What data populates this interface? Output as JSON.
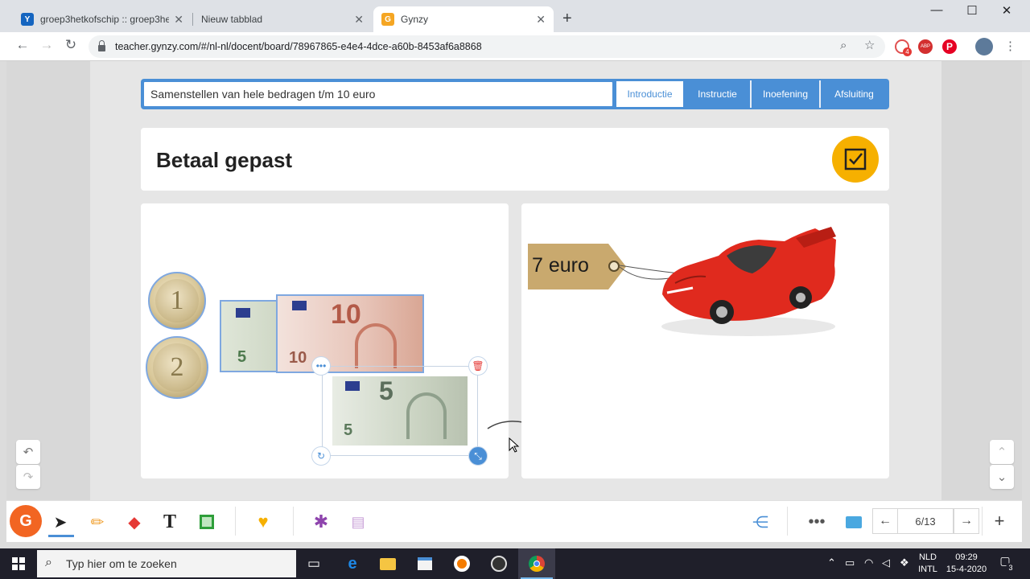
{
  "browser": {
    "tabs": [
      {
        "title": "groep3hetkofschip :: groep3hetk",
        "favicon": "Y",
        "favicon_color": "#1565c0"
      },
      {
        "title": "Nieuw tabblad",
        "favicon": "",
        "favicon_color": ""
      },
      {
        "title": "Gynzy",
        "favicon": "G",
        "favicon_color": "#f5a623"
      }
    ],
    "url": "teacher.gynzy.com/#/nl-nl/docent/board/78967865-e4e4-4dce-a60b-8453af6a8868",
    "extension_badge": "4"
  },
  "lesson": {
    "title_value": "Samenstellen van hele bedragen t/m 10 euro",
    "phases": [
      {
        "label": "Introductie",
        "active": true
      },
      {
        "label": "Instructie",
        "active": false
      },
      {
        "label": "Inoefening",
        "active": false
      },
      {
        "label": "Afsluiting",
        "active": false
      }
    ]
  },
  "board": {
    "heading": "Betaal gepast",
    "price_tag": "7 euro",
    "coins": [
      "1",
      "2"
    ],
    "notes": [
      "5",
      "10",
      "5"
    ],
    "accent_color": "#f6b000"
  },
  "gynzy_toolbar": {
    "page_indicator": "6/13"
  },
  "taskbar": {
    "search_placeholder": "Typ hier om te zoeken",
    "language": "NLD",
    "layout": "INTL",
    "time": "09:29",
    "date": "15-4-2020",
    "notifications": "3"
  }
}
